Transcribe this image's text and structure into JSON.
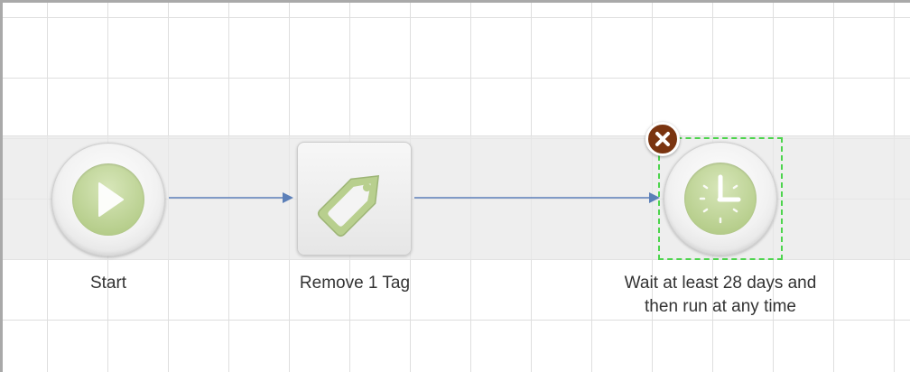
{
  "workflow": {
    "nodes": [
      {
        "id": "start",
        "label": "Start",
        "icon": "play-icon"
      },
      {
        "id": "remove-tag",
        "label": "Remove 1 Tag",
        "icon": "tag-icon"
      },
      {
        "id": "wait",
        "label_line1": "Wait at least 28 days and",
        "label_line2": "then run at any time",
        "icon": "clock-icon",
        "selected": true
      }
    ],
    "delete_icon": "close-icon"
  },
  "colors": {
    "connector": "#5b7fb8",
    "icon_green": "#b8cf8e",
    "selection": "#4cd44c",
    "delete_badge": "#7a3410"
  }
}
